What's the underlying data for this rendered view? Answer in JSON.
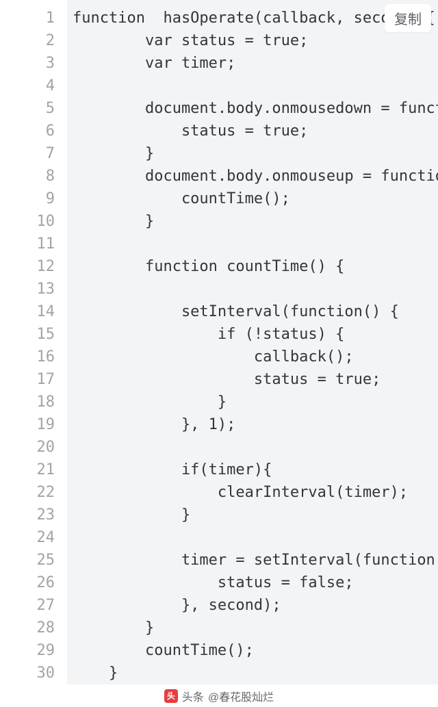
{
  "copy_label": "复制",
  "footer": {
    "source": "头条",
    "at": "@春花股灿烂"
  },
  "code": {
    "language": "javascript",
    "lines": [
      "function  hasOperate(callback, second) {",
      "        var status = true;",
      "        var timer;",
      "",
      "        document.body.onmousedown = function() {",
      "            status = true;",
      "        }",
      "        document.body.onmouseup = function() {",
      "            countTime();",
      "        }",
      "",
      "        function countTime() {",
      "",
      "            setInterval(function() {",
      "                if (!status) {",
      "                    callback();",
      "                    status = true;",
      "                }",
      "            }, 1);",
      "",
      "            if(timer){",
      "                clearInterval(timer);",
      "            }",
      "",
      "            timer = setInterval(function() {",
      "                status = false;",
      "            }, second);",
      "        }",
      "        countTime();",
      "    }"
    ]
  }
}
